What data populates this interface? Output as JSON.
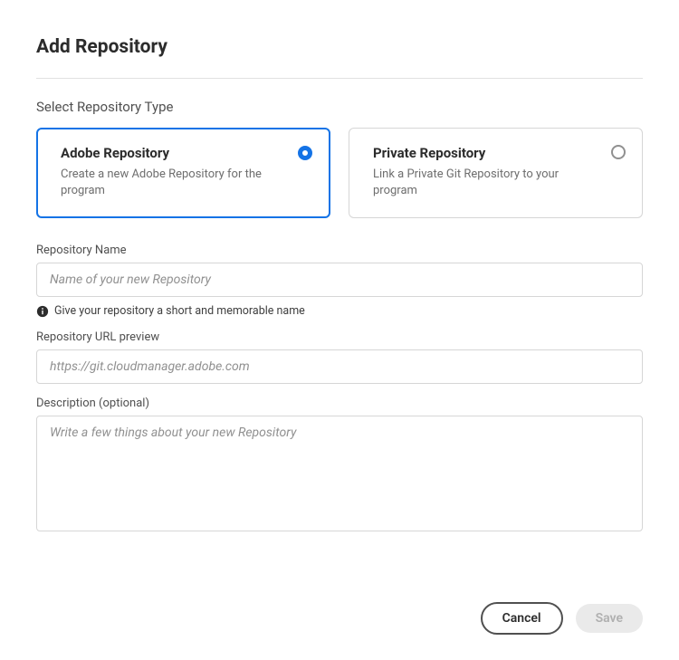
{
  "title": "Add Repository",
  "section_label": "Select Repository Type",
  "types": {
    "adobe": {
      "title": "Adobe Repository",
      "desc": "Create a new Adobe Repository for the program",
      "selected": true
    },
    "private": {
      "title": "Private Repository",
      "desc": "Link a Private Git Repository to your program",
      "selected": false
    }
  },
  "fields": {
    "name": {
      "label": "Repository Name",
      "placeholder": "Name of your new Repository",
      "helper": "Give your repository a short and memorable name"
    },
    "url": {
      "label": "Repository URL preview",
      "placeholder": "https://git.cloudmanager.adobe.com"
    },
    "description": {
      "label": "Description (optional)",
      "placeholder": "Write a few things about your new Repository"
    }
  },
  "buttons": {
    "cancel": "Cancel",
    "save": "Save"
  }
}
